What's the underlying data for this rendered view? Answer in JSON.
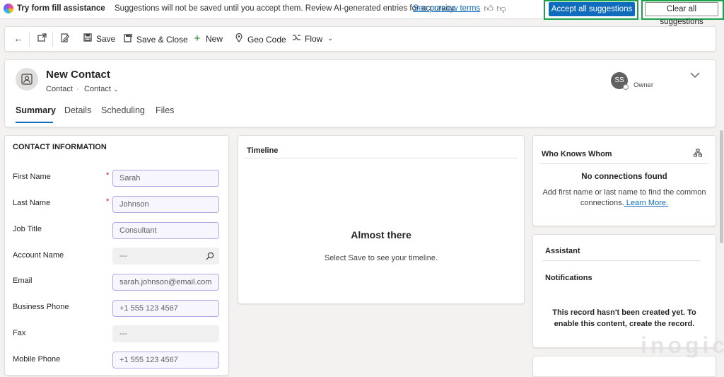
{
  "banner": {
    "title": "Try form fill assistance",
    "message": "Suggestions will not be saved until you accept them. Review AI-generated entries for accuracy.",
    "preview_link": "See preview terms",
    "accept_label": "Accept all suggestions",
    "clear_label": "Clear all suggestions"
  },
  "toolbar": {
    "save": "Save",
    "save_close": "Save & Close",
    "new": "New",
    "geo_code": "Geo Code",
    "flow": "Flow"
  },
  "header": {
    "title": "New Contact",
    "entity": "Contact",
    "separator": "·",
    "form": "Contact",
    "owner_initials": "SS",
    "owner_label": "Owner"
  },
  "tabs": [
    "Summary",
    "Details",
    "Scheduling",
    "Files"
  ],
  "contact_info": {
    "title": "CONTACT INFORMATION",
    "fields": [
      {
        "label": "First Name",
        "value": "Sarah",
        "required": "*"
      },
      {
        "label": "Last Name",
        "value": "Johnson",
        "required": "*"
      },
      {
        "label": "Job Title",
        "value": "Consultant"
      },
      {
        "label": "Account Name",
        "value": "---"
      },
      {
        "label": "Email",
        "value": "sarah.johnson@email.com"
      },
      {
        "label": "Business Phone",
        "value": "+1 555 123 4567"
      },
      {
        "label": "Fax",
        "value": "---"
      },
      {
        "label": "Mobile Phone",
        "value": "+1 555 123 4567"
      }
    ]
  },
  "timeline": {
    "title": "Timeline",
    "heading": "Almost there",
    "message": "Select Save to see your timeline."
  },
  "who_knows_whom": {
    "title": "Who Knows Whom",
    "empty_title": "No connections found",
    "message_line1": "Add first name or last name to find the common",
    "message_line2": "connections.",
    "learn_more": " Learn More."
  },
  "assistant": {
    "title": "Assistant",
    "notifications": "Notifications",
    "message_line1": "This record hasn't been created yet. To",
    "message_line2": "enable this content, create the record."
  },
  "watermark": "inogic",
  "colors": {
    "accent": "#0f6cbd",
    "highlight_border": "#19a34a",
    "ai_field_border": "#b4a7e7"
  }
}
